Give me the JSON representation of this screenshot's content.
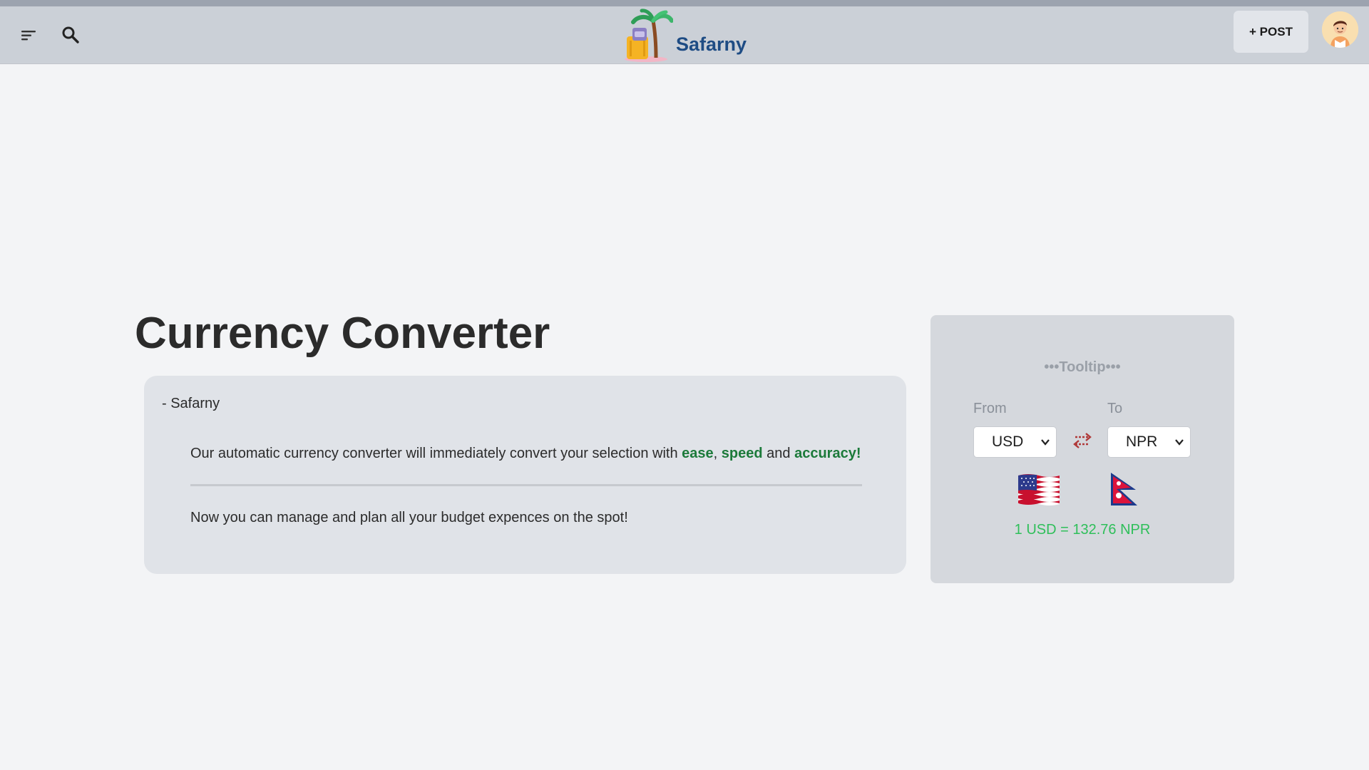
{
  "header": {
    "brand_name": "Safarny",
    "post_label": "+ POST"
  },
  "icons": {
    "menu": "menu-icon",
    "search": "search-icon",
    "logo": "luggage-palm-logo",
    "avatar": "user-avatar",
    "swap": "swap-arrows-icon",
    "from_flag": "us-flag",
    "to_flag": "nepal-flag"
  },
  "colors": {
    "navbar": "#cbd0d7",
    "brand": "#1e4c84",
    "highlight": "#1c7a3a",
    "rate": "#2fbf5a",
    "swap": "#b03a3a"
  },
  "main": {
    "title": "Currency Converter",
    "quote": {
      "author": "- Safarny",
      "line1_before": "Our automatic currency converter will immediately convert your selection with ",
      "ease": "ease",
      "comma": ",",
      "speed": "speed",
      "and": "and",
      "accuracy": "accuracy!",
      "line2": "Now you can manage and plan all your budget expences on the spot!"
    }
  },
  "converter": {
    "tooltip": "•••Tooltip•••",
    "from_label": "From",
    "to_label": "To",
    "from_value": "USD",
    "to_value": "NPR",
    "rate_text": "1 USD = 132.76 NPR"
  }
}
